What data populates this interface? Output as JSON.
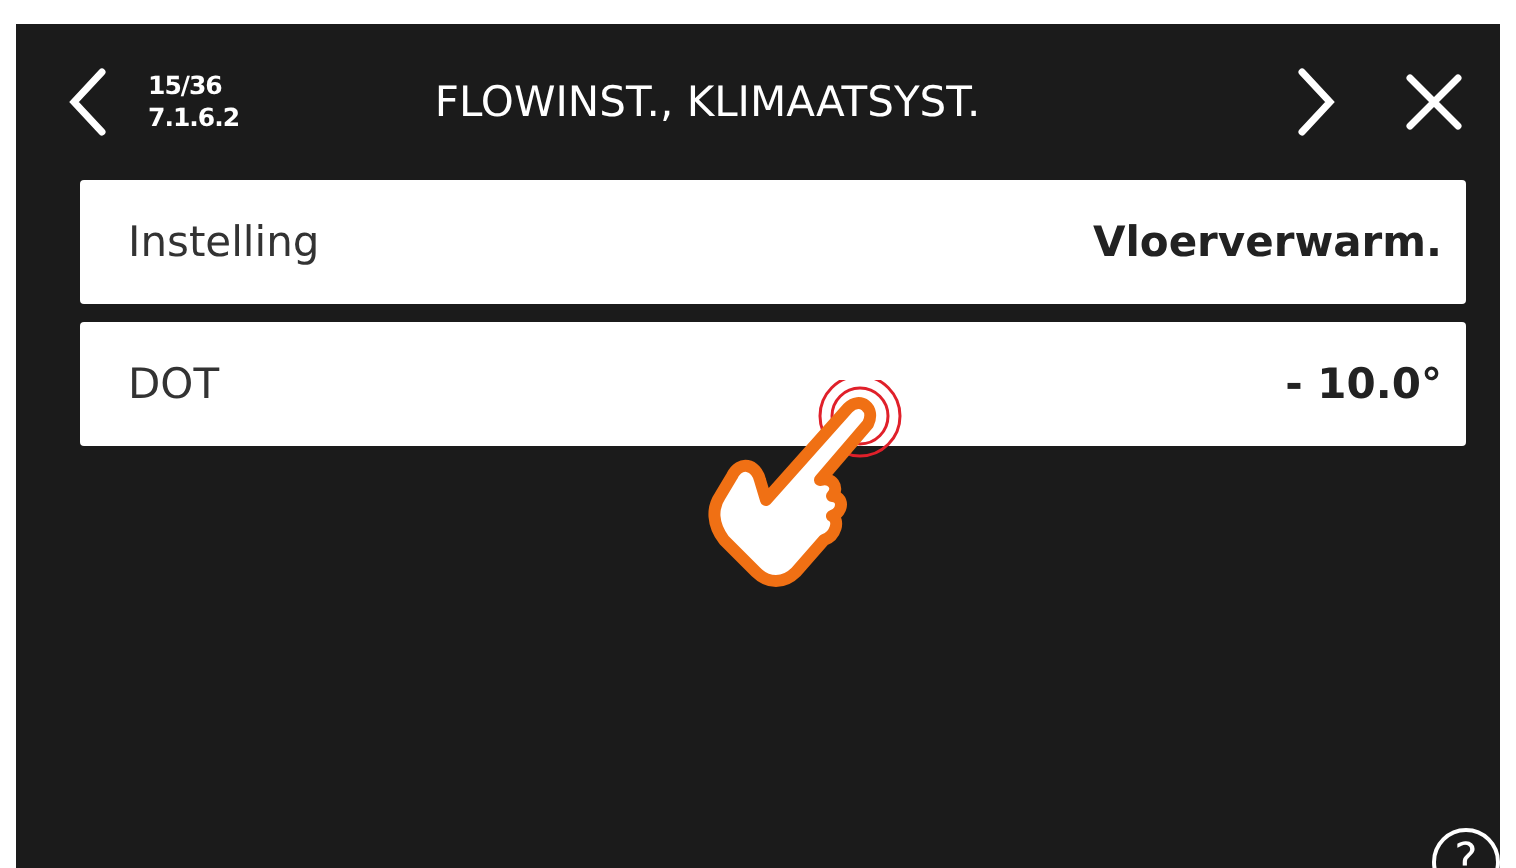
{
  "header": {
    "page": "15/36",
    "menu_number": "7.1.6.2",
    "title": "FLOWINST., KLIMAATSYST."
  },
  "rows": [
    {
      "label": "Instelling",
      "value": "Vloerverwarm."
    },
    {
      "label": "DOT",
      "value": "- 10.0°"
    }
  ],
  "help": {
    "label": "?"
  }
}
